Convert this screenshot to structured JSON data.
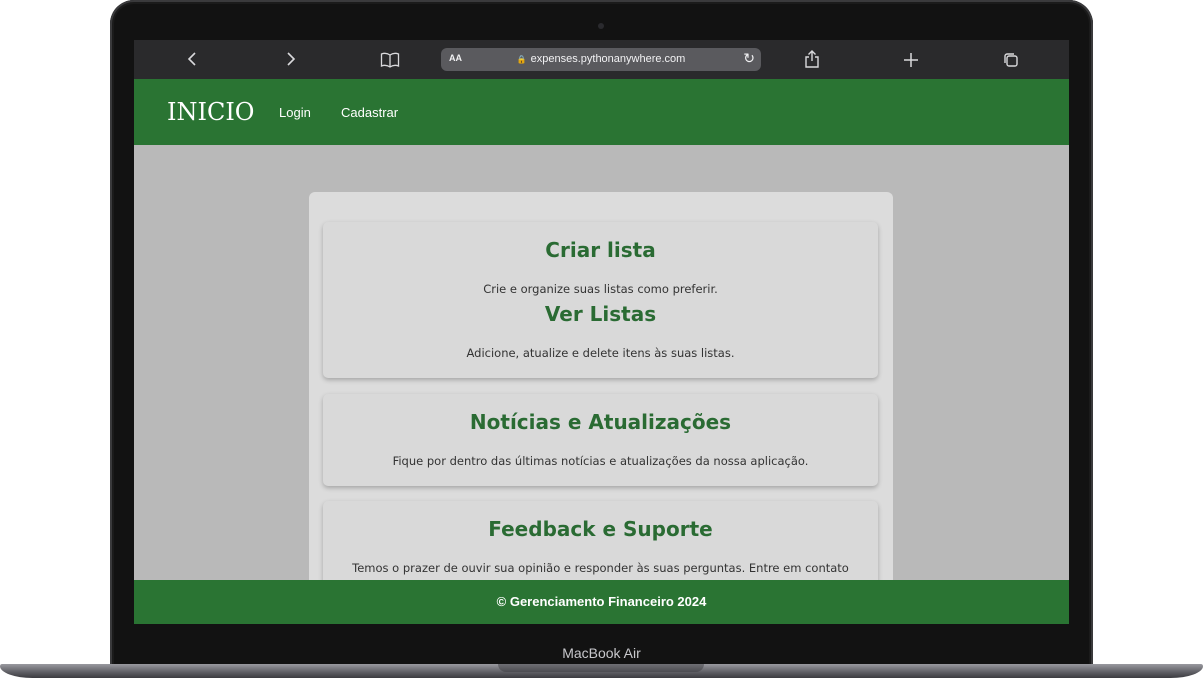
{
  "device": {
    "label": "MacBook Air"
  },
  "browser": {
    "back_icon": "chevron-left-icon",
    "forward_icon": "chevron-right-icon",
    "bookmarks_icon": "book-icon",
    "reader_label": "AA",
    "url": "expenses.pythonanywhere.com",
    "reload_icon": "reload-icon",
    "share_icon": "share-icon",
    "new_tab_icon": "plus-icon",
    "tabs_icon": "tabs-icon"
  },
  "header": {
    "brand": "INICIO",
    "nav": [
      "Login",
      "Cadastrar"
    ]
  },
  "cards": [
    {
      "sections": [
        {
          "title": "Criar lista",
          "text": "Crie e organize suas listas como preferir."
        },
        {
          "title": "Ver Listas",
          "text": "Adicione, atualize e delete itens às suas listas."
        }
      ]
    },
    {
      "sections": [
        {
          "title": "Notícias e Atualizações",
          "text": "Fique por dentro das últimas notícias e atualizações da nossa aplicação."
        }
      ]
    },
    {
      "sections": [
        {
          "title": "Feedback e Suporte",
          "text": "Temos o prazer de ouvir sua opinião e responder às suas perguntas. Entre em contato"
        }
      ]
    }
  ],
  "footer": {
    "text": "© Gerenciamento Financeiro 2024"
  },
  "colors": {
    "header_green": "#2a7433",
    "title_green": "#2a6b33",
    "page_background": "#b9b9b9",
    "card_background": "#d9d9d9"
  }
}
